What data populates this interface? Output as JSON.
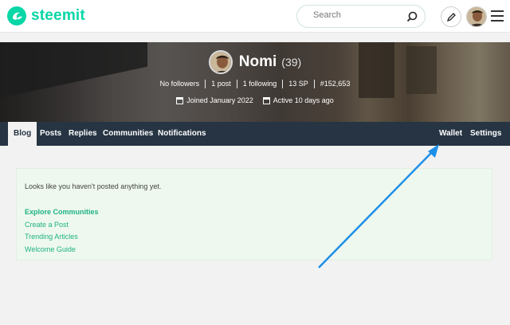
{
  "header": {
    "logo_text": "steemit",
    "search_placeholder": "Search",
    "icons": {
      "logo": "steemit-logo-icon",
      "search": "search-icon",
      "edit": "pencil-icon",
      "menu": "hamburger-menu-icon"
    }
  },
  "profile": {
    "name": "Nomi",
    "reputation": "(39)",
    "stats": [
      "No followers",
      "1 post",
      "1 following",
      "13 SP",
      "#152,653"
    ],
    "joined": "Joined January 2022",
    "active": "Active 10 days ago"
  },
  "nav": {
    "tabs": [
      "Blog",
      "Posts",
      "Replies",
      "Communities",
      "Notifications"
    ],
    "right_tabs": [
      "Wallet",
      "Settings"
    ],
    "active": "Blog"
  },
  "content": {
    "empty_message": "Looks like you haven't posted anything yet.",
    "links": [
      "Explore Communities",
      "Create a Post",
      "Trending Articles",
      "Welcome Guide"
    ]
  },
  "colors": {
    "brand": "#07d6a6",
    "nav_bg": "#263443",
    "link": "#1fb283",
    "card_bg": "#eef8ee",
    "annotation_arrow": "#1e8fe8"
  }
}
